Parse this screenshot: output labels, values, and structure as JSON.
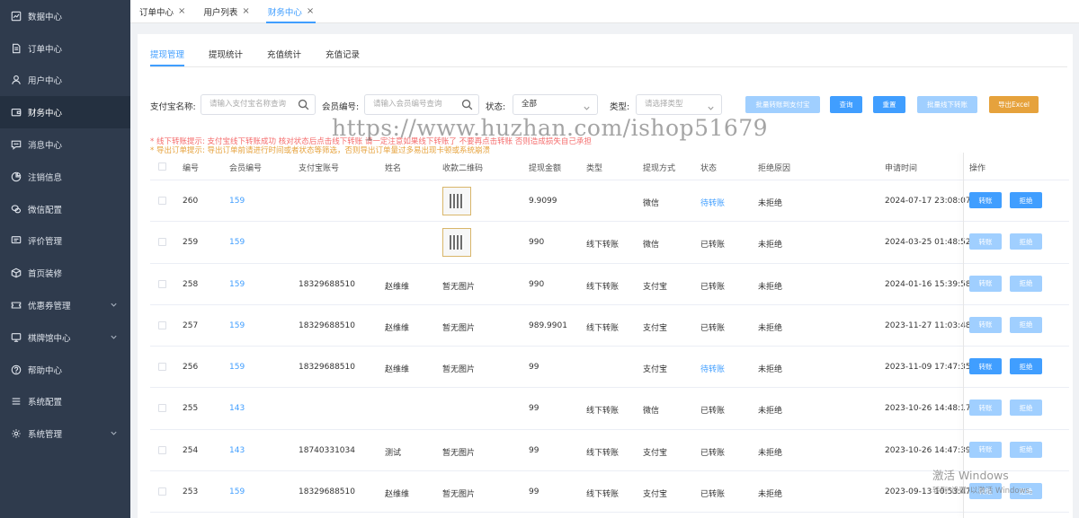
{
  "sidebar": {
    "items": [
      {
        "label": "数据中心",
        "icon": "chart-icon",
        "name": "sidebar-item-data-center",
        "active": false,
        "chevron": false
      },
      {
        "label": "订单中心",
        "icon": "document-icon",
        "name": "sidebar-item-order-center",
        "active": false,
        "chevron": false
      },
      {
        "label": "用户中心",
        "icon": "user-icon",
        "name": "sidebar-item-user-center",
        "active": false,
        "chevron": false
      },
      {
        "label": "财务中心",
        "icon": "wallet-icon",
        "name": "sidebar-item-finance-center",
        "active": true,
        "chevron": false
      },
      {
        "label": "消息中心",
        "icon": "message-icon",
        "name": "sidebar-item-message-center",
        "active": false,
        "chevron": false
      },
      {
        "label": "注销信息",
        "icon": "pie-icon",
        "name": "sidebar-item-cancellation-info",
        "active": false,
        "chevron": false
      },
      {
        "label": "微信配置",
        "icon": "wechat-icon",
        "name": "sidebar-item-wechat-config",
        "active": false,
        "chevron": false
      },
      {
        "label": "评价管理",
        "icon": "comment-icon",
        "name": "sidebar-item-review-management",
        "active": false,
        "chevron": false
      },
      {
        "label": "首页装修",
        "icon": "box-icon",
        "name": "sidebar-item-home-decoration",
        "active": false,
        "chevron": false
      },
      {
        "label": "优惠券管理",
        "icon": "coupon-icon",
        "name": "sidebar-item-coupon-management",
        "active": false,
        "chevron": true
      },
      {
        "label": "棋牌馆中心",
        "icon": "monitor-icon",
        "name": "sidebar-item-chess-hall-center",
        "active": false,
        "chevron": true
      },
      {
        "label": "帮助中心",
        "icon": "help-icon",
        "name": "sidebar-item-help-center",
        "active": false,
        "chevron": false
      },
      {
        "label": "系统配置",
        "icon": "menu-icon",
        "name": "sidebar-item-system-config",
        "active": false,
        "chevron": false
      },
      {
        "label": "系统管理",
        "icon": "gear-icon",
        "name": "sidebar-item-system-management",
        "active": false,
        "chevron": true
      }
    ]
  },
  "tabs": [
    {
      "label": "订单中心",
      "close": "×",
      "active": false
    },
    {
      "label": "用户列表",
      "close": "×",
      "active": false
    },
    {
      "label": "财务中心",
      "close": "×",
      "active": true
    }
  ],
  "subtabs": [
    {
      "label": "提现管理",
      "active": true
    },
    {
      "label": "提现统计",
      "active": false
    },
    {
      "label": "充值统计",
      "active": false
    },
    {
      "label": "充值记录",
      "active": false
    }
  ],
  "filters": {
    "alipay_label": "支付宝名称:",
    "alipay_placeholder": "请输入支付宝名称查询",
    "member_label": "会员编号:",
    "member_placeholder": "请输入会员编号查询",
    "status_label": "状态:",
    "status_value": "全部",
    "type_label": "类型:",
    "type_placeholder": "请选择类型",
    "btn_batch_alipay": "批量转账到支付宝",
    "btn_query": "查询",
    "btn_reset": "重置",
    "btn_batch_offline": "批量线下转账",
    "btn_export": "导出Excel"
  },
  "watermark": "https://www.huzhan.com/ishop51679",
  "notices": {
    "offline_tip": "* 线下转账提示:  支付宝线下转账成功 核对状态后点击线下转账 请一定注意如果线下转账了 不要再点击转账 否则造成损失自己承担",
    "export_tip": "* 导出订单提示:  导出订单前请进行时间或者状态等筛选，否则导出订单量过多易出现卡顿或系统崩溃"
  },
  "table": {
    "headers": [
      "编号",
      "会员编号",
      "支付宝账号",
      "姓名",
      "收款二维码",
      "提现金额",
      "类型",
      "提现方式",
      "状态",
      "拒绝原因",
      "申请时间",
      "操作"
    ],
    "transfer_label": "转账",
    "reject_label": "拒绝",
    "rows": [
      {
        "id": "260",
        "member": "159",
        "account": "",
        "name": "",
        "qr": "image",
        "amount": "9.9099",
        "type": "",
        "method": "微信",
        "status": "待转账",
        "reason": "未拒绝",
        "time": "2024-07-17 23:08:07",
        "enabled": true
      },
      {
        "id": "259",
        "member": "159",
        "account": "",
        "name": "",
        "qr": "image",
        "amount": "990",
        "type": "线下转账",
        "method": "微信",
        "status": "已转账",
        "reason": "未拒绝",
        "time": "2024-03-25 01:48:52",
        "enabled": false
      },
      {
        "id": "258",
        "member": "159",
        "account": "18329688510",
        "name": "赵维维",
        "qr": "暂无图片",
        "amount": "990",
        "type": "线下转账",
        "method": "支付宝",
        "status": "已转账",
        "reason": "未拒绝",
        "time": "2024-01-16 15:39:58",
        "enabled": false
      },
      {
        "id": "257",
        "member": "159",
        "account": "18329688510",
        "name": "赵维维",
        "qr": "暂无图片",
        "amount": "989.9901",
        "type": "线下转账",
        "method": "支付宝",
        "status": "已转账",
        "reason": "未拒绝",
        "time": "2023-11-27 11:03:48",
        "enabled": false
      },
      {
        "id": "256",
        "member": "159",
        "account": "18329688510",
        "name": "赵维维",
        "qr": "暂无图片",
        "amount": "99",
        "type": "",
        "method": "支付宝",
        "status": "待转账",
        "reason": "未拒绝",
        "time": "2023-11-09 17:47:35",
        "enabled": true
      },
      {
        "id": "255",
        "member": "143",
        "account": "",
        "name": "",
        "qr": "",
        "amount": "99",
        "type": "线下转账",
        "method": "微信",
        "status": "已转账",
        "reason": "未拒绝",
        "time": "2023-10-26 14:48:17",
        "enabled": false
      },
      {
        "id": "254",
        "member": "143",
        "account": "18740331034",
        "name": "测试",
        "qr": "暂无图片",
        "amount": "99",
        "type": "线下转账",
        "method": "支付宝",
        "status": "已转账",
        "reason": "未拒绝",
        "time": "2023-10-26 14:47:39",
        "enabled": false
      },
      {
        "id": "253",
        "member": "159",
        "account": "18329688510",
        "name": "赵维维",
        "qr": "暂无图片",
        "amount": "99",
        "type": "线下转账",
        "method": "支付宝",
        "status": "已转账",
        "reason": "未拒绝",
        "time": "2023-09-13 10:53:47",
        "enabled": false
      }
    ]
  },
  "windows_watermark": {
    "line1": "激活 Windows",
    "line2": "转到\"设置\"以激活 Windows。"
  }
}
